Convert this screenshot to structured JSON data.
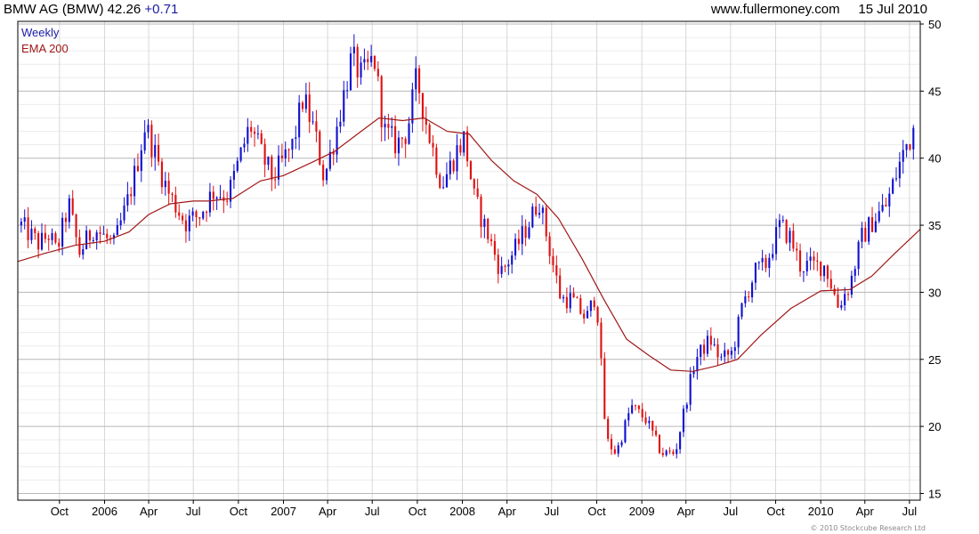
{
  "header": {
    "title": "BMW AG (BMW)",
    "price": "42.26",
    "change": "+0.71",
    "site": "www.fullermoney.com",
    "date": "15 Jul 2010"
  },
  "footer": "© 2010 Stockcube Research Ltd",
  "colors": {
    "up": "#1010d0",
    "down": "#e01010",
    "ema": "#a01818",
    "grid": "#d8d8d8",
    "grid_major": "#b8b8b8",
    "weekly_label": "#1a1aa6"
  },
  "chart_data": {
    "type": "candlestick",
    "title": "BMW AG (BMW) 42.26 +0.71",
    "legend": [
      "Weekly",
      "EMA 200"
    ],
    "legend_position": "top-left",
    "y_axis_side": "right",
    "grid": true,
    "ylim": [
      14.5,
      50.2
    ],
    "y_ticks": [
      15,
      20,
      25,
      30,
      35,
      40,
      45,
      50
    ],
    "x_range": [
      "2005-07-08",
      "2010-07-23"
    ],
    "x_ticks": [
      {
        "date": "2005-10-01",
        "label": "Oct"
      },
      {
        "date": "2006-01-01",
        "label": "2006"
      },
      {
        "date": "2006-04-01",
        "label": "Apr"
      },
      {
        "date": "2006-07-01",
        "label": "Jul"
      },
      {
        "date": "2006-10-01",
        "label": "Oct"
      },
      {
        "date": "2007-01-01",
        "label": "2007"
      },
      {
        "date": "2007-04-01",
        "label": "Apr"
      },
      {
        "date": "2007-07-01",
        "label": "Jul"
      },
      {
        "date": "2007-10-01",
        "label": "Oct"
      },
      {
        "date": "2008-01-01",
        "label": "2008"
      },
      {
        "date": "2008-04-01",
        "label": "Apr"
      },
      {
        "date": "2008-07-01",
        "label": "Jul"
      },
      {
        "date": "2008-10-01",
        "label": "Oct"
      },
      {
        "date": "2009-01-01",
        "label": "2009"
      },
      {
        "date": "2009-04-01",
        "label": "Apr"
      },
      {
        "date": "2009-07-01",
        "label": "Jul"
      },
      {
        "date": "2009-10-01",
        "label": "Oct"
      },
      {
        "date": "2010-01-01",
        "label": "2010"
      },
      {
        "date": "2010-04-01",
        "label": "Apr"
      },
      {
        "date": "2010-07-01",
        "label": "Jul"
      }
    ],
    "price_path": [
      [
        "2005-07-15",
        35.0
      ],
      [
        "2005-08-20",
        33.6
      ],
      [
        "2005-09-10",
        34.3
      ],
      [
        "2005-09-25",
        33.0
      ],
      [
        "2005-10-20",
        36.6
      ],
      [
        "2005-11-10",
        32.9
      ],
      [
        "2005-12-10",
        34.8
      ],
      [
        "2006-01-20",
        33.5
      ],
      [
        "2006-02-15",
        36.5
      ],
      [
        "2006-03-05",
        39.0
      ],
      [
        "2006-03-25",
        42.5
      ],
      [
        "2006-05-10",
        37.5
      ],
      [
        "2006-06-15",
        35.2
      ],
      [
        "2006-07-15",
        35.8
      ],
      [
        "2006-08-10",
        37.5
      ],
      [
        "2006-09-10",
        37.2
      ],
      [
        "2006-10-25",
        42.5
      ],
      [
        "2006-11-20",
        40.0
      ],
      [
        "2006-12-10",
        38.5
      ],
      [
        "2007-01-20",
        41.0
      ],
      [
        "2007-02-10",
        44.5
      ],
      [
        "2007-03-05",
        42.0
      ],
      [
        "2007-03-25",
        38.5
      ],
      [
        "2007-04-15",
        41.5
      ],
      [
        "2007-05-20",
        47.5
      ],
      [
        "2007-06-10",
        46.0
      ],
      [
        "2007-07-05",
        47.5
      ],
      [
        "2007-07-25",
        42.0
      ],
      [
        "2007-08-20",
        41.0
      ],
      [
        "2007-09-10",
        42.0
      ],
      [
        "2007-09-30",
        46.0
      ],
      [
        "2007-10-20",
        42.5
      ],
      [
        "2007-11-20",
        38.0
      ],
      [
        "2007-12-20",
        40.5
      ],
      [
        "2008-01-05",
        41.5
      ],
      [
        "2008-01-25",
        37.0
      ],
      [
        "2008-02-20",
        34.5
      ],
      [
        "2008-03-20",
        31.5
      ],
      [
        "2008-04-15",
        33.0
      ],
      [
        "2008-05-20",
        35.5
      ],
      [
        "2008-06-05",
        37.0
      ],
      [
        "2008-06-25",
        33.5
      ],
      [
        "2008-07-20",
        29.5
      ],
      [
        "2008-08-10",
        29.5
      ],
      [
        "2008-09-10",
        28.0
      ],
      [
        "2008-09-30",
        30.0
      ],
      [
        "2008-10-20",
        19.0
      ],
      [
        "2008-11-10",
        18.0
      ],
      [
        "2008-12-10",
        21.5
      ],
      [
        "2009-01-10",
        20.5
      ],
      [
        "2009-02-10",
        18.0
      ],
      [
        "2009-03-10",
        18.0
      ],
      [
        "2009-03-30",
        21.5
      ],
      [
        "2009-04-20",
        25.0
      ],
      [
        "2009-05-20",
        26.5
      ],
      [
        "2009-06-10",
        25.0
      ],
      [
        "2009-07-05",
        25.5
      ],
      [
        "2009-07-25",
        29.0
      ],
      [
        "2009-08-20",
        31.5
      ],
      [
        "2009-09-10",
        32.0
      ],
      [
        "2009-10-10",
        35.0
      ],
      [
        "2009-11-01",
        34.0
      ],
      [
        "2009-11-20",
        32.0
      ],
      [
        "2009-12-15",
        32.0
      ],
      [
        "2010-01-10",
        32.0
      ],
      [
        "2010-02-05",
        29.0
      ],
      [
        "2010-03-01",
        30.5
      ],
      [
        "2010-03-25",
        34.0
      ],
      [
        "2010-04-20",
        35.5
      ],
      [
        "2010-05-15",
        36.5
      ],
      [
        "2010-06-10",
        39.5
      ],
      [
        "2010-06-25",
        41.0
      ],
      [
        "2010-07-15",
        42.26
      ]
    ],
    "ema200_path": [
      [
        "2005-07-08",
        32.3
      ],
      [
        "2005-09-01",
        32.9
      ],
      [
        "2005-11-01",
        33.5
      ],
      [
        "2006-01-01",
        33.8
      ],
      [
        "2006-02-20",
        34.5
      ],
      [
        "2006-04-01",
        35.8
      ],
      [
        "2006-05-15",
        36.6
      ],
      [
        "2006-07-01",
        36.8
      ],
      [
        "2006-08-01",
        36.8
      ],
      [
        "2006-09-20",
        37.0
      ],
      [
        "2006-11-15",
        38.3
      ],
      [
        "2007-01-01",
        38.7
      ],
      [
        "2007-03-01",
        39.7
      ],
      [
        "2007-04-15",
        40.5
      ],
      [
        "2007-06-01",
        41.8
      ],
      [
        "2007-07-15",
        43.0
      ],
      [
        "2007-09-01",
        42.8
      ],
      [
        "2007-10-15",
        43.0
      ],
      [
        "2007-12-01",
        42.0
      ],
      [
        "2008-01-15",
        41.8
      ],
      [
        "2008-03-01",
        39.8
      ],
      [
        "2008-04-15",
        38.3
      ],
      [
        "2008-06-01",
        37.3
      ],
      [
        "2008-07-15",
        35.5
      ],
      [
        "2008-09-01",
        32.5
      ],
      [
        "2008-10-15",
        29.5
      ],
      [
        "2008-12-01",
        26.5
      ],
      [
        "2009-01-15",
        25.3
      ],
      [
        "2009-03-01",
        24.2
      ],
      [
        "2009-04-15",
        24.1
      ],
      [
        "2009-06-01",
        24.5
      ],
      [
        "2009-07-15",
        25.0
      ],
      [
        "2009-09-01",
        26.8
      ],
      [
        "2009-11-01",
        28.8
      ],
      [
        "2010-01-01",
        30.1
      ],
      [
        "2010-03-01",
        30.2
      ],
      [
        "2010-04-15",
        31.2
      ],
      [
        "2010-06-01",
        32.9
      ],
      [
        "2010-07-23",
        34.7
      ]
    ]
  }
}
